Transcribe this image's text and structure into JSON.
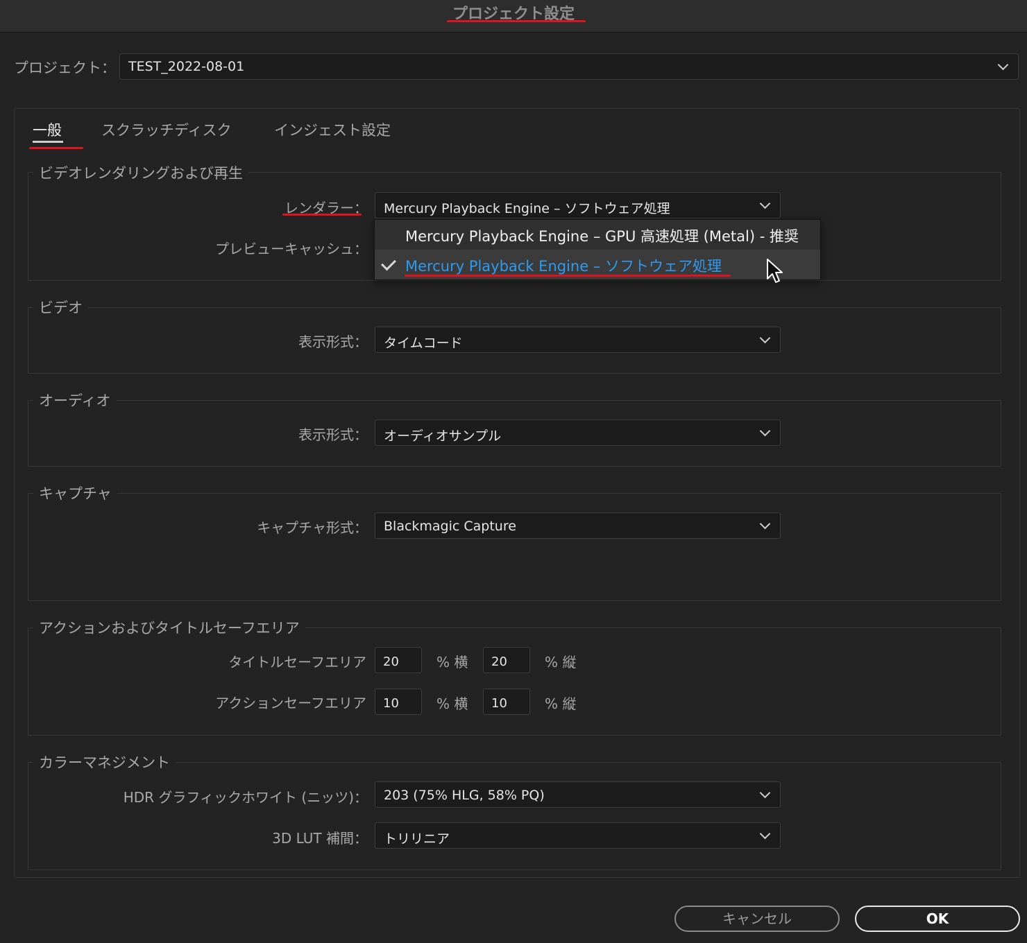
{
  "window": {
    "title": "プロジェクト設定"
  },
  "project": {
    "label": "プロジェクト：",
    "value": "TEST_2022-08-01"
  },
  "tabs": [
    {
      "label": "一般"
    },
    {
      "label": "スクラッチディスク"
    },
    {
      "label": "インジェスト設定"
    }
  ],
  "video_render": {
    "title": "ビデオレンダリングおよび再生",
    "renderer_label": "レンダラー：",
    "renderer_value": "Mercury Playback Engine – ソフトウェア処理",
    "preview_cache_label": "プレビューキャッシュ：",
    "dropdown_options": [
      {
        "label": "Mercury Playback Engine – GPU 高速処理 (Metal) - 推奨",
        "selected": false
      },
      {
        "label": "Mercury Playback Engine – ソフトウェア処理",
        "selected": true
      }
    ]
  },
  "video": {
    "title": "ビデオ",
    "format_label": "表示形式：",
    "format_value": "タイムコード"
  },
  "audio": {
    "title": "オーディオ",
    "format_label": "表示形式：",
    "format_value": "オーディオサンプル"
  },
  "capture": {
    "title": "キャプチャ",
    "format_label": "キャプチャ形式：",
    "format_value": "Blackmagic Capture"
  },
  "safe_area": {
    "title": "アクションおよびタイトルセーフエリア",
    "title_safe_label": "タイトルセーフエリア",
    "title_h": "20",
    "title_v": "20",
    "action_safe_label": "アクションセーフエリア",
    "action_h": "10",
    "action_v": "10",
    "unit_h": "% 横",
    "unit_v": "% 縦"
  },
  "color": {
    "title": "カラーマネジメント",
    "hdr_label": "HDR グラフィックホワイト (ニッツ)：",
    "hdr_value": "203 (75% HLG, 58% PQ)",
    "lut_label": "3D LUT 補間：",
    "lut_value": "トリリニア"
  },
  "buttons": {
    "cancel": "キャンセル",
    "ok": "OK"
  },
  "colors": {
    "accent_blue": "#2f9bf0",
    "annotation_red": "#e0141e",
    "background": "#232323"
  }
}
